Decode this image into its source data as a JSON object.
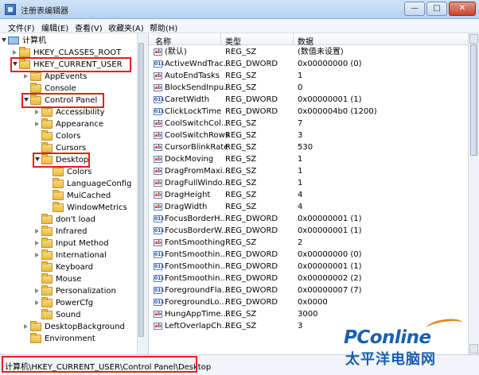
{
  "window": {
    "title": "注册表编辑器",
    "minimize": "—",
    "maximize": "□",
    "close": "✕"
  },
  "menu": [
    "文件(F)",
    "编辑(E)",
    "查看(V)",
    "收藏夹(A)",
    "帮助(H)"
  ],
  "tree": [
    {
      "label": "计算机",
      "level": 0,
      "icon": "computer-icon",
      "arrow": "open"
    },
    {
      "label": "HKEY_CLASSES_ROOT",
      "level": 1,
      "icon": "folder-icon",
      "arrow": "closed"
    },
    {
      "label": "HKEY_CURRENT_USER",
      "level": 1,
      "icon": "folder-icon",
      "arrow": "open"
    },
    {
      "label": "AppEvents",
      "level": 2,
      "icon": "folder-icon",
      "arrow": "closed"
    },
    {
      "label": "Console",
      "level": 2,
      "icon": "folder-icon",
      "arrow": "none"
    },
    {
      "label": "Control Panel",
      "level": 2,
      "icon": "folder-icon",
      "arrow": "open"
    },
    {
      "label": "Accessibility",
      "level": 3,
      "icon": "folder-icon",
      "arrow": "closed"
    },
    {
      "label": "Appearance",
      "level": 3,
      "icon": "folder-icon",
      "arrow": "closed"
    },
    {
      "label": "Colors",
      "level": 3,
      "icon": "folder-icon",
      "arrow": "none"
    },
    {
      "label": "Cursors",
      "level": 3,
      "icon": "folder-icon",
      "arrow": "none"
    },
    {
      "label": "Desktop",
      "level": 3,
      "icon": "folder-icon",
      "arrow": "open"
    },
    {
      "label": "Colors",
      "level": 4,
      "icon": "folder-icon",
      "arrow": "none"
    },
    {
      "label": "LanguageConfig",
      "level": 4,
      "icon": "folder-icon",
      "arrow": "none"
    },
    {
      "label": "MuiCached",
      "level": 4,
      "icon": "folder-icon",
      "arrow": "none"
    },
    {
      "label": "WindowMetrics",
      "level": 4,
      "icon": "folder-icon",
      "arrow": "none"
    },
    {
      "label": "don't load",
      "level": 3,
      "icon": "folder-icon",
      "arrow": "none"
    },
    {
      "label": "Infrared",
      "level": 3,
      "icon": "folder-icon",
      "arrow": "closed"
    },
    {
      "label": "Input Method",
      "level": 3,
      "icon": "folder-icon",
      "arrow": "closed"
    },
    {
      "label": "International",
      "level": 3,
      "icon": "folder-icon",
      "arrow": "closed"
    },
    {
      "label": "Keyboard",
      "level": 3,
      "icon": "folder-icon",
      "arrow": "none"
    },
    {
      "label": "Mouse",
      "level": 3,
      "icon": "folder-icon",
      "arrow": "none"
    },
    {
      "label": "Personalization",
      "level": 3,
      "icon": "folder-icon",
      "arrow": "closed"
    },
    {
      "label": "PowerCfg",
      "level": 3,
      "icon": "folder-icon",
      "arrow": "closed"
    },
    {
      "label": "Sound",
      "level": 3,
      "icon": "folder-icon",
      "arrow": "none"
    },
    {
      "label": "DesktopBackground",
      "level": 2,
      "icon": "folder-icon",
      "arrow": "closed"
    },
    {
      "label": "Environment",
      "level": 2,
      "icon": "folder-icon",
      "arrow": "none"
    }
  ],
  "columns": {
    "name": "名称",
    "type": "类型",
    "data": "数据"
  },
  "values": [
    {
      "name": "(默认)",
      "type": "REG_SZ",
      "data": "(数值未设置)"
    },
    {
      "name": "ActiveWndTrac...",
      "type": "REG_DWORD",
      "data": "0x00000000 (0)"
    },
    {
      "name": "AutoEndTasks",
      "type": "REG_SZ",
      "data": "1"
    },
    {
      "name": "BlockSendInpu...",
      "type": "REG_SZ",
      "data": "0"
    },
    {
      "name": "CaretWidth",
      "type": "REG_DWORD",
      "data": "0x00000001 (1)"
    },
    {
      "name": "ClickLockTime",
      "type": "REG_DWORD",
      "data": "0x000004b0 (1200)"
    },
    {
      "name": "CoolSwitchCol...",
      "type": "REG_SZ",
      "data": "7"
    },
    {
      "name": "CoolSwitchRows",
      "type": "REG_SZ",
      "data": "3"
    },
    {
      "name": "CursorBlinkRate",
      "type": "REG_SZ",
      "data": "530"
    },
    {
      "name": "DockMoving",
      "type": "REG_SZ",
      "data": "1"
    },
    {
      "name": "DragFromMaxi...",
      "type": "REG_SZ",
      "data": "1"
    },
    {
      "name": "DragFullWindo...",
      "type": "REG_SZ",
      "data": "1"
    },
    {
      "name": "DragHeight",
      "type": "REG_SZ",
      "data": "4"
    },
    {
      "name": "DragWidth",
      "type": "REG_SZ",
      "data": "4"
    },
    {
      "name": "FocusBorderH...",
      "type": "REG_DWORD",
      "data": "0x00000001 (1)"
    },
    {
      "name": "FocusBorderW...",
      "type": "REG_DWORD",
      "data": "0x00000001 (1)"
    },
    {
      "name": "FontSmoothing",
      "type": "REG_SZ",
      "data": "2"
    },
    {
      "name": "FontSmoothin...",
      "type": "REG_DWORD",
      "data": "0x00000000 (0)"
    },
    {
      "name": "FontSmoothin...",
      "type": "REG_DWORD",
      "data": "0x00000001 (1)"
    },
    {
      "name": "FontSmoothin...",
      "type": "REG_DWORD",
      "data": "0x00000002 (2)"
    },
    {
      "name": "ForegroundFla...",
      "type": "REG_DWORD",
      "data": "0x00000007 (7)"
    },
    {
      "name": "ForegroundLo...",
      "type": "REG_DWORD",
      "data": "0x0000"
    },
    {
      "name": "HungAppTime...",
      "type": "REG_SZ",
      "data": "3000"
    },
    {
      "name": "LeftOverlapCh...",
      "type": "REG_SZ",
      "data": "3"
    }
  ],
  "status": "计算机\\HKEY_CURRENT_USER\\Control Panel\\Desktop",
  "watermark": {
    "brand": "PConline",
    "cn": "太平洋电脑网"
  }
}
